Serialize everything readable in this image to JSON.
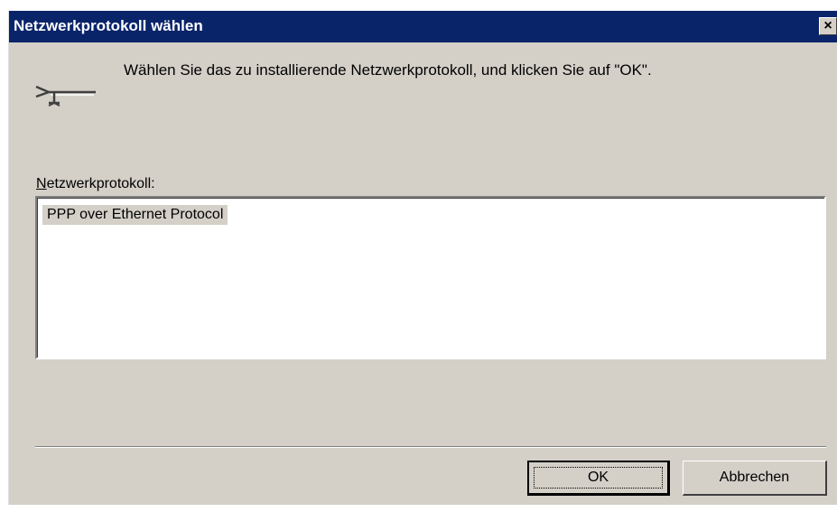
{
  "dialog": {
    "title": "Netzwerkprotokoll wählen",
    "close_glyph": "×",
    "icon": "network-protocol-icon",
    "instruction": "Wählen Sie das zu installierende Netzwerkprotokoll, und klicken Sie auf \"OK\".",
    "list_label_accel": "N",
    "list_label_rest": "etzwerkprotokoll:",
    "protocols": [
      {
        "label": "PPP over Ethernet Protocol",
        "selected": true
      }
    ],
    "buttons": {
      "ok_label": "OK",
      "cancel_label": "Abbrechen"
    }
  },
  "colors": {
    "titlebar": "#0a246a",
    "face": "#d4d0c8"
  }
}
